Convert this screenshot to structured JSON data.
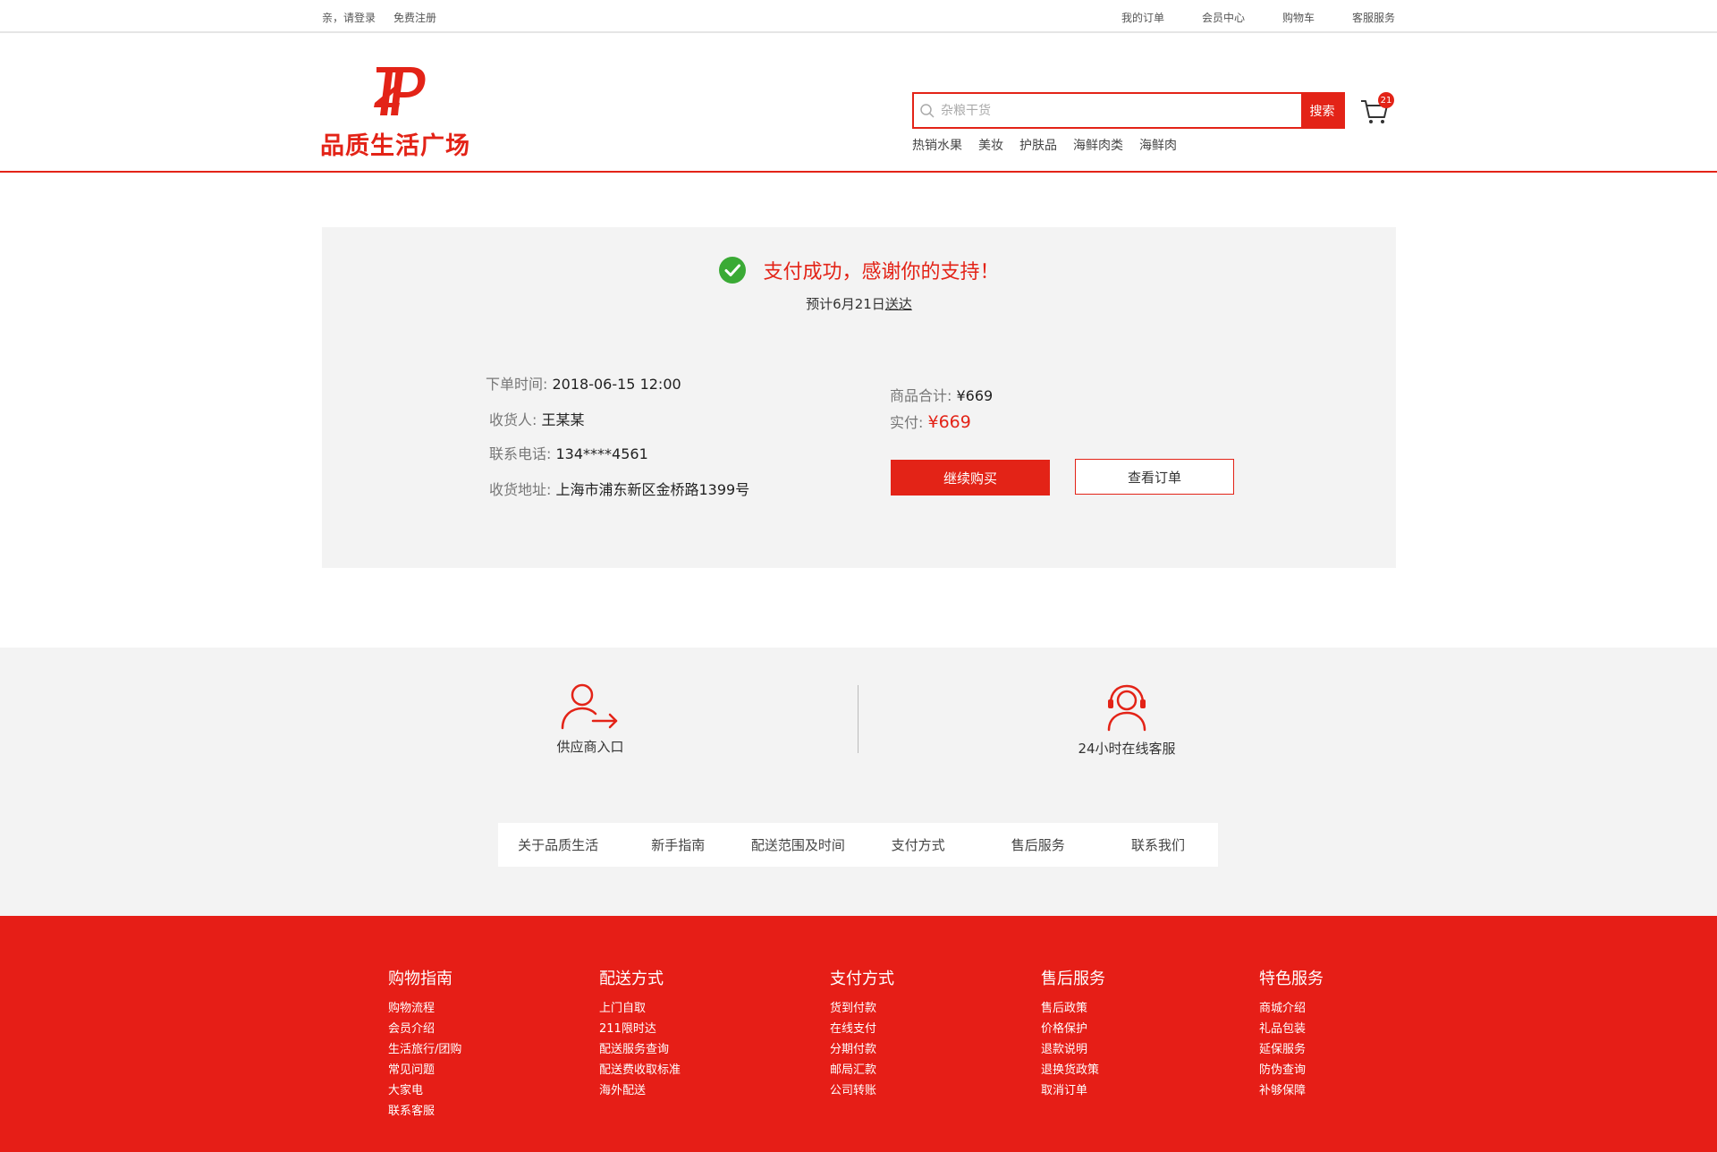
{
  "topbar": {
    "login": "亲，请登录",
    "register": "免费注册",
    "links": [
      "我的订单",
      "会员中心",
      "购物车",
      "客服服务"
    ]
  },
  "header": {
    "logo_text": "品质生活广场",
    "search_placeholder": "杂粮干货",
    "search_button": "搜索",
    "cart_count": "21",
    "hot_links": [
      "热销水果",
      "美妆",
      "护肤品",
      "海鲜肉类",
      "海鲜肉"
    ]
  },
  "success": {
    "message": "支付成功，感谢你的支持！",
    "eta_prefix": "预计6月21日",
    "eta_suffix": "送达",
    "order_time_label": "下单时间:",
    "order_time": "2018-06-15 12:00",
    "receiver_label": "收货人:",
    "receiver": "王某某",
    "phone_label": "联系电话:",
    "phone": "134****4561",
    "address_label": "收货地址:",
    "address": "上海市浦东新区金桥路1399号",
    "subtotal_label": "商品合计:",
    "subtotal": "¥669",
    "paid_label": "实付:",
    "paid": "¥669",
    "continue_button": "继续购买",
    "view_order_button": "查看订单"
  },
  "service": {
    "supplier": "供应商入口",
    "support": "24小时在线客服",
    "nav": [
      "关于品质生活",
      "新手指南",
      "配送范围及时间",
      "支付方式",
      "售后服务",
      "联系我们"
    ]
  },
  "footer": {
    "columns": [
      {
        "title": "购物指南",
        "items": [
          "购物流程",
          "会员介绍",
          "生活旅行/团购",
          "常见问题",
          "大家电",
          "联系客服"
        ]
      },
      {
        "title": "配送方式",
        "items": [
          "上门自取",
          "211限时达",
          "配送服务查询",
          "配送费收取标准",
          "海外配送"
        ]
      },
      {
        "title": "支付方式",
        "items": [
          "货到付款",
          "在线支付",
          "分期付款",
          "邮局汇款",
          "公司转账"
        ]
      },
      {
        "title": "售后服务",
        "items": [
          "售后政策",
          "价格保护",
          "退款说明",
          "退换货政策",
          "取消订单"
        ]
      },
      {
        "title": "特色服务",
        "items": [
          "商城介绍",
          "礼品包装",
          "延保服务",
          "防伪查询",
          "补够保障"
        ]
      }
    ]
  },
  "colors": {
    "accent": "#e32317",
    "footer_bg": "#e61e17",
    "panel_bg": "#f3f3f3",
    "success_green": "#3aaa35"
  }
}
